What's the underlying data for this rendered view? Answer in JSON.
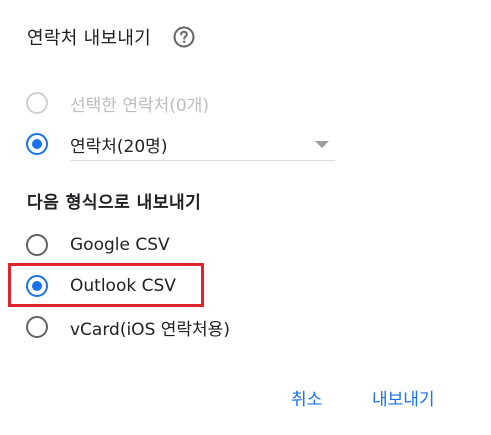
{
  "dialog": {
    "title": "연락처 내보내기"
  },
  "scope": {
    "options": [
      {
        "label": "선택한 연락처(0개)",
        "selected": false,
        "disabled": true
      },
      {
        "label": "연락처(20명)",
        "selected": true,
        "disabled": false
      }
    ]
  },
  "format": {
    "heading": "다음 형식으로 내보내기",
    "options": [
      {
        "label": "Google CSV",
        "selected": false
      },
      {
        "label": "Outlook CSV",
        "selected": true
      },
      {
        "label": "vCard(iOS 연락처용)",
        "selected": false
      }
    ],
    "highlight_color": "#e0242e"
  },
  "footer": {
    "cancel_label": "취소",
    "export_label": "내보내기"
  },
  "colors": {
    "accent": "#1a73e8",
    "radio_unselected": "#5f6368",
    "radio_disabled": "#bdbdbd"
  }
}
